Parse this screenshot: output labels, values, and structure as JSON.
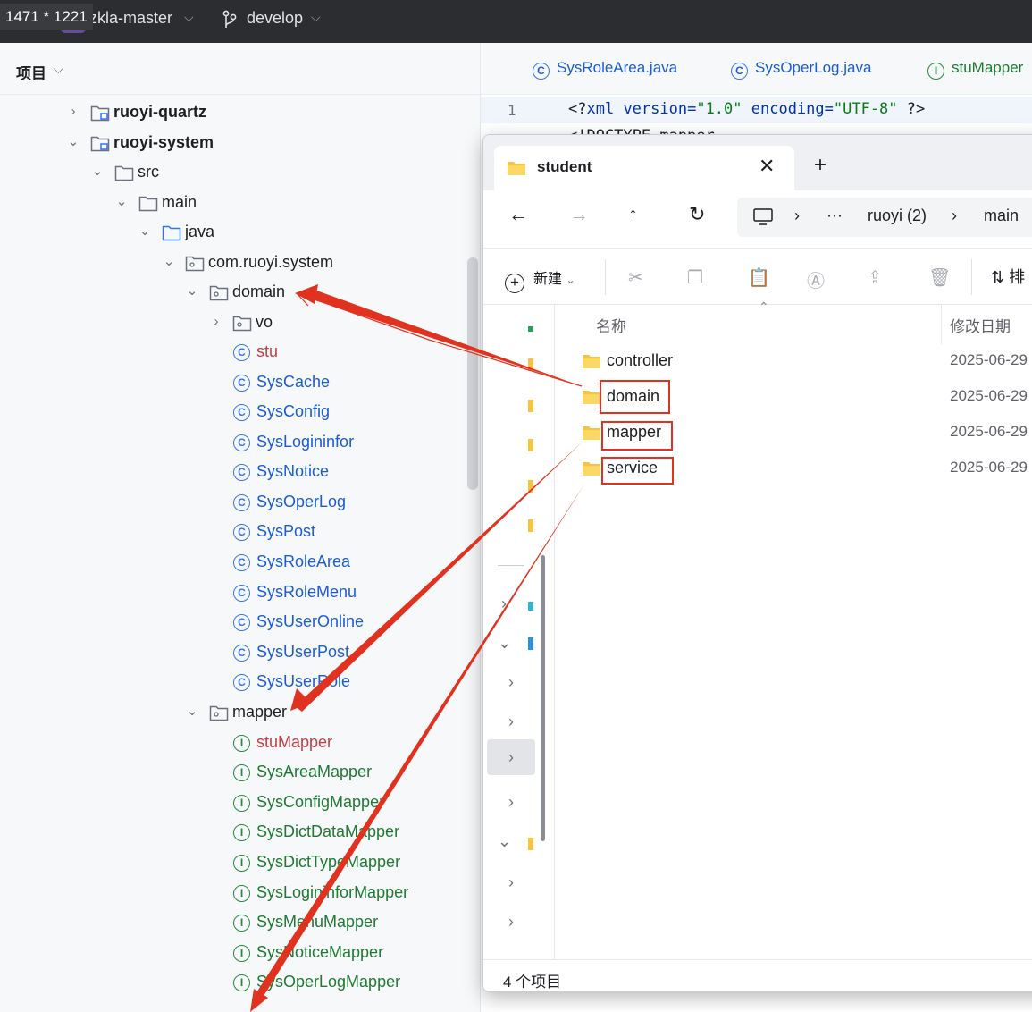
{
  "overlay": {
    "dimensions_badge": "1471 * 1221"
  },
  "topbar": {
    "project_avatar": "ZK",
    "project_name": "zkla-master",
    "branch": "develop"
  },
  "project_pane": {
    "title": "项目",
    "tree": {
      "ruoyi_quartz": "ruoyi-quartz",
      "ruoyi_system": "ruoyi-system",
      "src": "src",
      "main": "main",
      "java": "java",
      "package": "com.ruoyi.system",
      "domain": "domain",
      "vo": "vo",
      "domain_classes": [
        "stu",
        "SysCache",
        "SysConfig",
        "SysLogininfor",
        "SysNotice",
        "SysOperLog",
        "SysPost",
        "SysRoleArea",
        "SysRoleMenu",
        "SysUserOnline",
        "SysUserPost",
        "SysUserRole"
      ],
      "mapper": "mapper",
      "mapper_interfaces": [
        "stuMapper",
        "SysAreaMapper",
        "SysConfigMapper",
        "SysDictDataMapper",
        "SysDictTypeMapper",
        "SysLogininforMapper",
        "SysMenuMapper",
        "SysNoticeMapper",
        "SysOperLogMapper"
      ]
    }
  },
  "editor": {
    "tabs": [
      "SysRoleArea.java",
      "SysOperLog.java",
      "stuMapper"
    ],
    "line_number": "1",
    "code_line": {
      "open": "<?",
      "tag": "xml",
      "attr1": " version=",
      "val1": "\"1.0\"",
      "attr2": " encoding=",
      "val2": "\"UTF-8\"",
      "close": " ?>"
    },
    "code_line_2": "<!DOCTYPE mapper"
  },
  "explorer": {
    "tab_title": "student",
    "breadcrumb": [
      "ruoyi (2)",
      "main"
    ],
    "new_label": "新建",
    "sort_label": "排",
    "columns": {
      "name": "名称",
      "modified": "修改日期"
    },
    "files": [
      {
        "name": "controller",
        "modified": "2025-06-29"
      },
      {
        "name": "domain",
        "modified": "2025-06-29"
      },
      {
        "name": "mapper",
        "modified": "2025-06-29"
      },
      {
        "name": "service",
        "modified": "2025-06-29"
      }
    ],
    "status": "4 个项目",
    "colors": {
      "annotation": "#e0321e",
      "folder": "#f6c445"
    }
  }
}
